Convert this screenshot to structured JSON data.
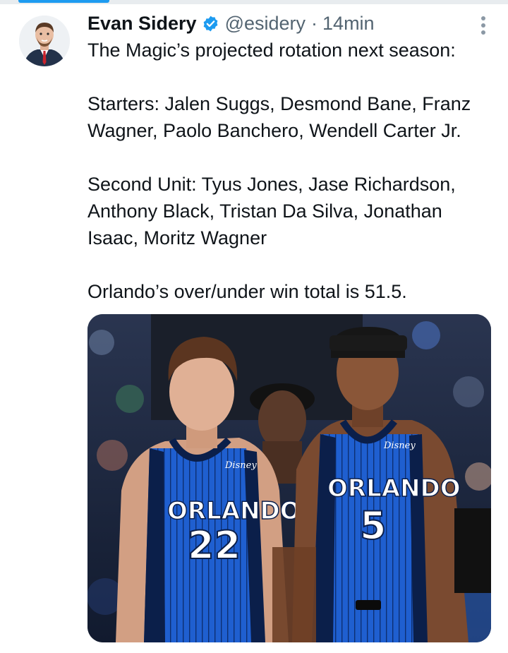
{
  "author": {
    "name": "Evan Sidery",
    "handle": "@esidery",
    "separator": "·",
    "time": "14min",
    "verified_icon": "verified-badge-icon"
  },
  "tweet": {
    "paragraphs": [
      "The Magic’s projected rotation next season:",
      "Starters: Jalen Suggs, Desmond Bane, Franz Wagner, Paolo Banchero, Wendell Carter Jr.",
      "Second Unit: Tyus Jones, Jase Richardson, Anthony Black, Tristan Da Silva, Jonathan Isaac, Moritz Wagner",
      "Orlando’s over/under win total is 51.5."
    ]
  },
  "media": {
    "left_jersey": {
      "team": "ORLANDO",
      "number": "22"
    },
    "right_jersey": {
      "team": "ORLANDO",
      "number": "5"
    },
    "sponsor": "Disney"
  },
  "colors": {
    "accent": "#1d9bf0",
    "verified": "#1d9bf0",
    "jersey_blue": "#1f5fd0",
    "muted_text": "#536471"
  }
}
